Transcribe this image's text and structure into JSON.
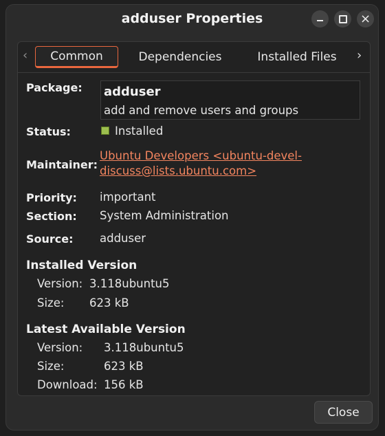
{
  "window": {
    "title": "adduser Properties",
    "close_icon": "×"
  },
  "tabs": {
    "prev_arrow": "‹",
    "next_arrow": "›",
    "items": [
      {
        "label": "Common",
        "active": true
      },
      {
        "label": "Dependencies",
        "active": false
      },
      {
        "label": "Installed Files",
        "active": false
      }
    ]
  },
  "details": {
    "package_label": "Package:",
    "package_name": "adduser",
    "package_description": "add and remove users and groups",
    "status_label": "Status:",
    "status_value": "Installed",
    "status_color": "#9cbe4f",
    "maintainer_label": "Maintainer:",
    "maintainer_link": "Ubuntu Developers <ubuntu-devel-discuss@lists.ubuntu.com>",
    "priority_label": "Priority:",
    "priority_value": "important",
    "section_label": "Section:",
    "section_value": "System Administration",
    "source_label": "Source:",
    "source_value": "adduser"
  },
  "installed_version": {
    "heading": "Installed Version",
    "version_label": "Version:",
    "version_value": "3.118ubuntu5",
    "size_label": "Size:",
    "size_value": "623 kB"
  },
  "latest_version": {
    "heading": "Latest Available Version",
    "version_label": "Version:",
    "version_value": "3.118ubuntu5",
    "size_label": "Size:",
    "size_value": "623 kB",
    "download_label": "Download:",
    "download_value": "156 kB"
  },
  "footer": {
    "close_label": "Close"
  },
  "colors": {
    "accent": "#e9673e",
    "link": "#f3855f"
  }
}
